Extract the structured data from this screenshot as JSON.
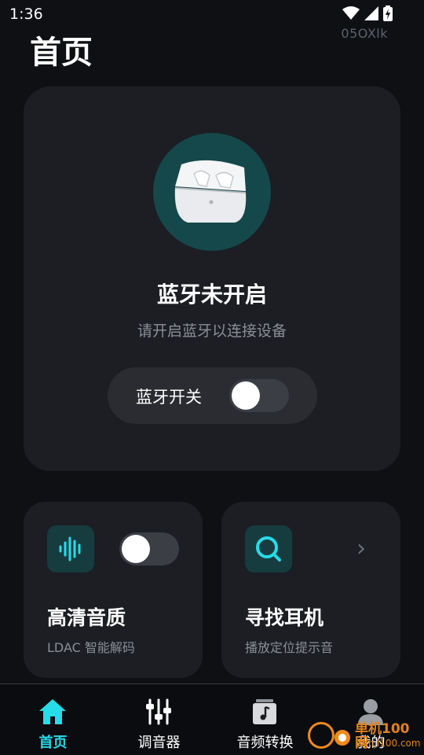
{
  "status_bar": {
    "time": "1:36",
    "device_code": "05OXlk"
  },
  "page": {
    "title": "首页"
  },
  "bluetooth_card": {
    "title": "蓝牙未开启",
    "subtitle": "请开启蓝牙以连接设备",
    "switch_label": "蓝牙开关",
    "switch_on": false
  },
  "features": {
    "hd_audio": {
      "title": "高清音质",
      "subtitle": "LDAC 智能解码",
      "toggle_on": false
    },
    "find_earbuds": {
      "title": "寻找耳机",
      "subtitle": "播放定位提示音",
      "chevron": "›"
    }
  },
  "nav": {
    "items": [
      {
        "label": "首页",
        "icon": "home-icon",
        "active": true
      },
      {
        "label": "调音器",
        "icon": "equalizer-icon",
        "active": false
      },
      {
        "label": "音频转换",
        "icon": "music-file-icon",
        "active": false
      },
      {
        "label": "我的",
        "icon": "profile-icon",
        "active": false
      }
    ]
  },
  "watermark": {
    "text": "单机100网",
    "url": "danji100.com"
  },
  "colors": {
    "accent": "#27dbe8",
    "card": "#1c1e23",
    "background": "#0f1014",
    "icon_bg": "#163c40"
  }
}
